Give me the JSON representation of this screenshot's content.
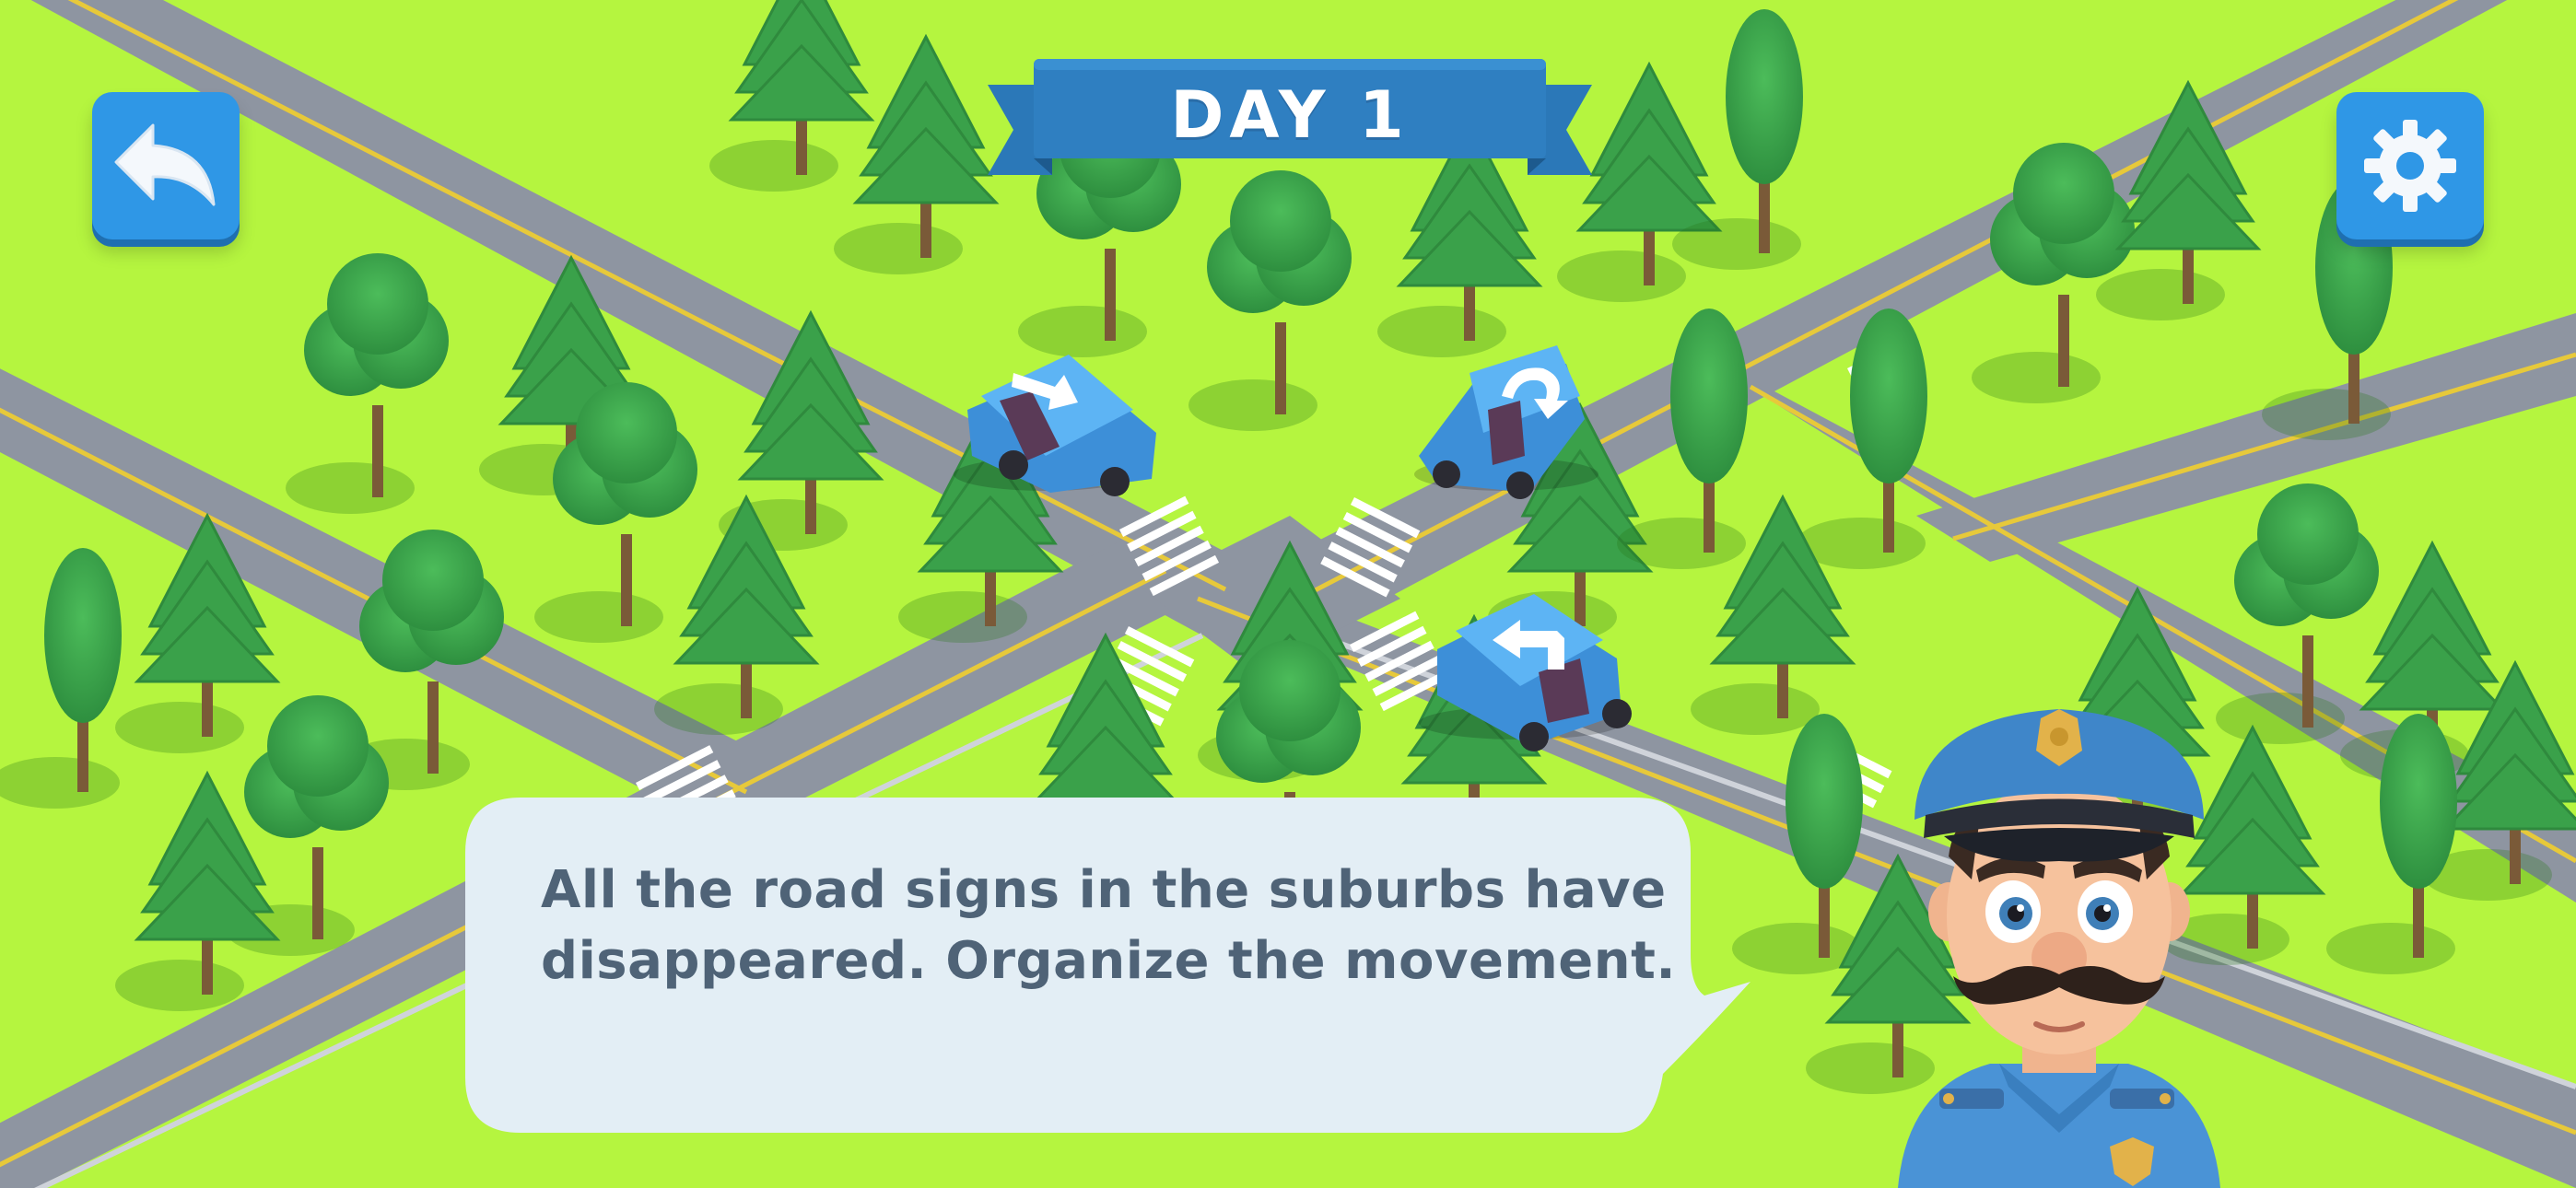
{
  "header": {
    "day_label": "DAY 1"
  },
  "toolbar": {
    "back_icon": "back-arrow-icon",
    "settings_icon": "gear-icon"
  },
  "dialog": {
    "speaker": "police-officer",
    "text": "All the road signs in the suburbs have disappeared. Organize the movement."
  },
  "cars": [
    {
      "name": "car-top-left",
      "sign": "arrow-right-down"
    },
    {
      "name": "car-top-right",
      "sign": "u-turn"
    },
    {
      "name": "car-center",
      "sign": "turn-left"
    }
  ],
  "colors": {
    "grass": "#b5f53f",
    "road": "#8e95a1",
    "ui_blue": "#2f97e6",
    "banner_blue": "#2d7fc0",
    "bubble": "#e3eef5",
    "bubble_text": "#4f6377",
    "car_blue": "#4aa6ee",
    "tree_green": "#3aa14a"
  }
}
